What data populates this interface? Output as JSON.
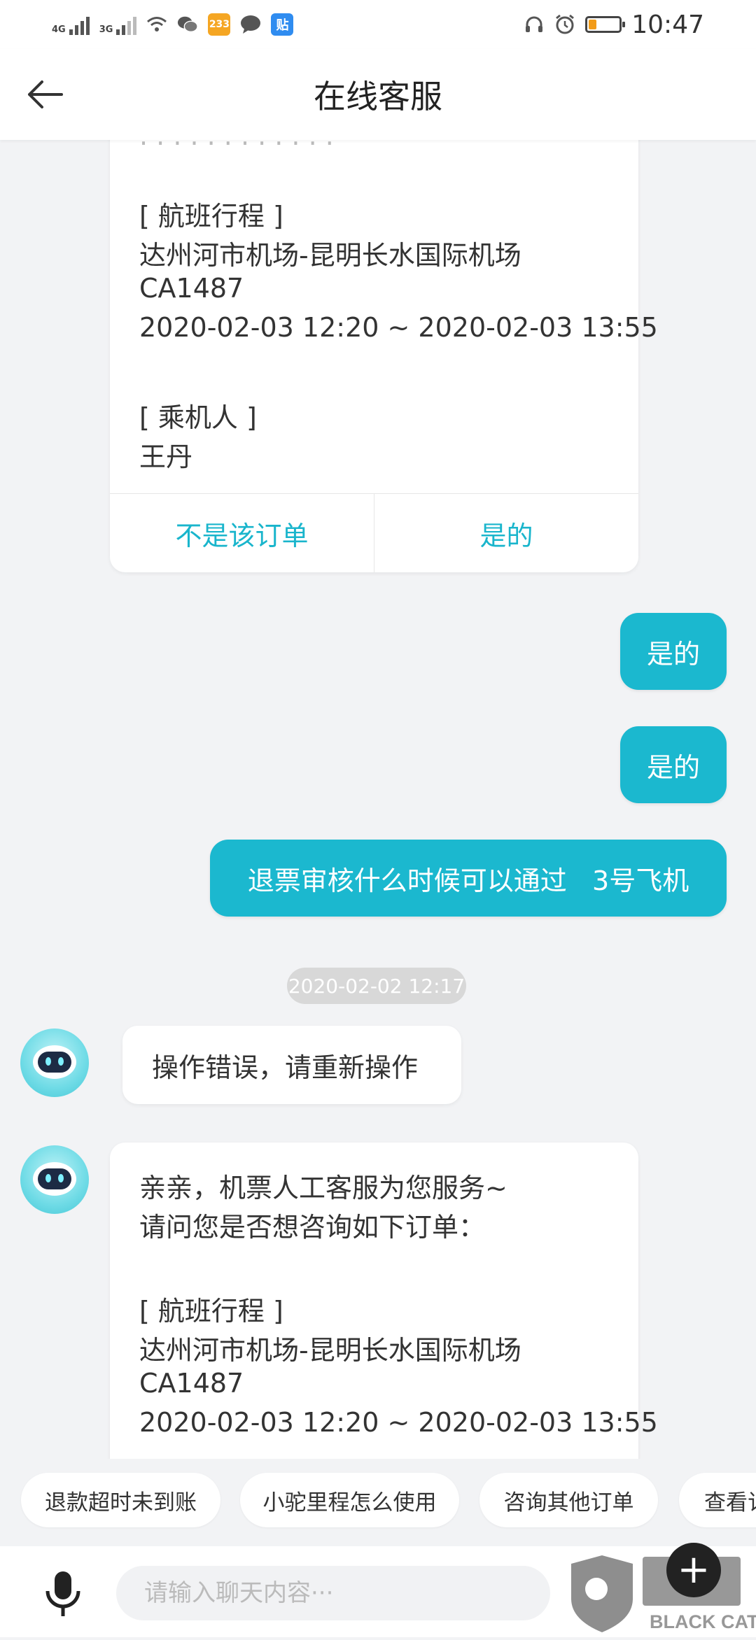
{
  "status_bar": {
    "network1": "4G",
    "network2": "3G",
    "time": "10:47",
    "battery_level": 0.25,
    "app_badge_1": "233",
    "app_badge_2": "贴"
  },
  "header": {
    "title": "在线客服"
  },
  "order_card_top": {
    "section_route": "[ 航班行程 ]",
    "route": "达州河市机场-昆明长水国际机场",
    "flight_no": "CA1487",
    "flight_time": "2020-02-03 12:20 ~ 2020-02-03 13:55",
    "section_passenger": "[ 乘机人 ]",
    "passenger": "王丹",
    "btn_not_order": "不是该订单",
    "btn_yes": "是的"
  },
  "user_messages": [
    {
      "text": "是的"
    },
    {
      "text": "是的"
    },
    {
      "text": "退票审核什么时候可以通过   3号飞机"
    }
  ],
  "timestamp": "2020-02-02 12:17",
  "bot_messages": [
    {
      "text": "操作错误，请重新操作"
    }
  ],
  "order_card_bottom": {
    "greeting": "亲亲，机票人工客服为您服务~",
    "question": "请问您是否想咨询如下订单：",
    "section_route": "[ 航班行程 ]",
    "route": "达州河市机场-昆明长水国际机场",
    "flight_no": "CA1487",
    "flight_time": "2020-02-03 12:20 ~ 2020-02-03 13:55"
  },
  "quick_replies": [
    "退款超时未到账",
    "小驼里程怎么使用",
    "咨询其他订单",
    "查看订"
  ],
  "input": {
    "placeholder": "请输入聊天内容···"
  },
  "watermark": {
    "text": "BLACK CAT"
  },
  "colors": {
    "accent": "#1bb8cf",
    "background": "#f2f3f5"
  }
}
